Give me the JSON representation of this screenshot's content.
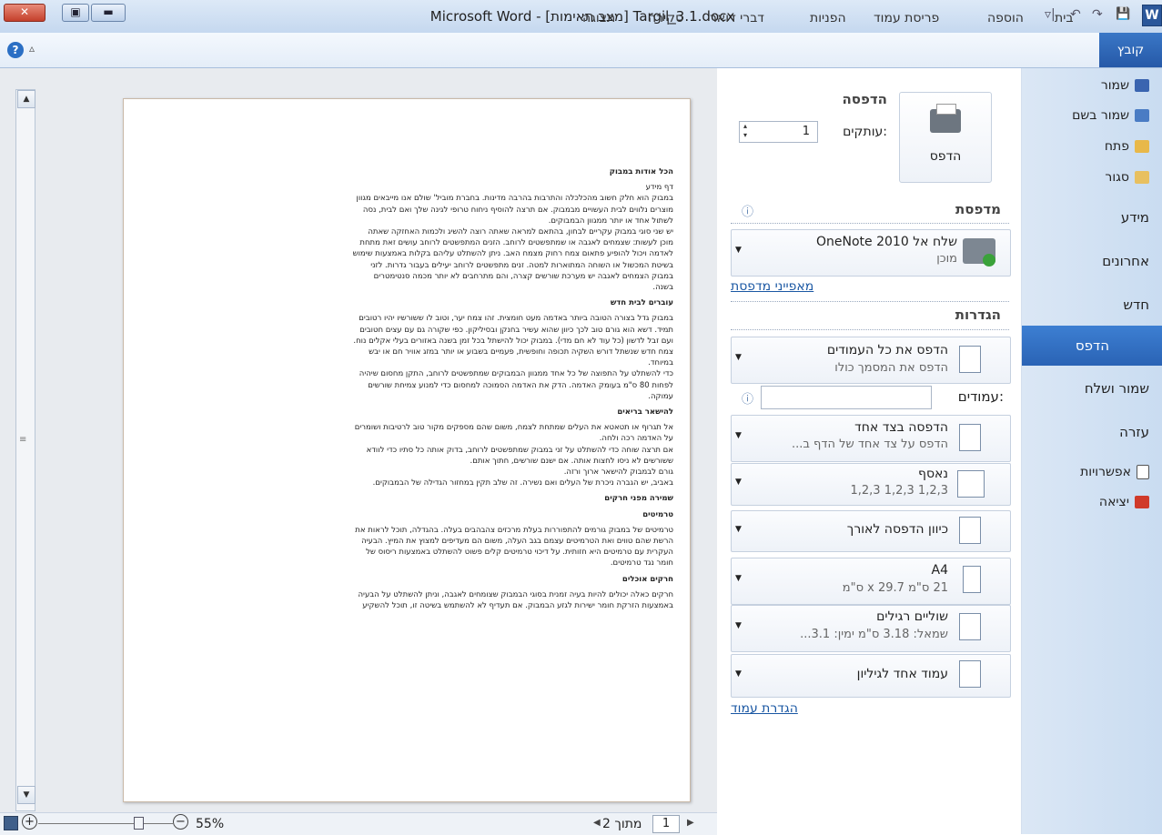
{
  "window": {
    "title": "Microsoft Word - [מצב תאימות] Targil_3.1.docx",
    "close": "✕",
    "max": "▣",
    "min": "▬",
    "qat": [
      "▿|",
      "↶",
      "↷",
      "💾"
    ],
    "word_icon": "W"
  },
  "ribbon": {
    "file_tab": "קובץ",
    "tabs": [
      "בית",
      "הוספה",
      "פריסת עמוד",
      "הפניות",
      "דברי דואר",
      "סקירה",
      "תצוגה"
    ],
    "help": "?",
    "collapse": "▵"
  },
  "nav": {
    "save": "שמור",
    "save_as": "שמור בשם",
    "open": "פתח",
    "close": "סגור",
    "info": "מידע",
    "recent": "אחרונים",
    "new": "חדש",
    "print": "הדפס",
    "save_send": "שמור ושלח",
    "help": "עזרה",
    "options": "אפשרויות",
    "exit": "יציאה"
  },
  "print": {
    "heading": "הדפסה",
    "print_button": "הדפס",
    "copies_label": "עותקים:",
    "copies_value": "1",
    "printer_heading": "מדפסת",
    "printer_name": "שלח אל OneNote 2010",
    "printer_status": "מוכן",
    "printer_props": "מאפייני מדפסת",
    "settings_heading": "הגדרות",
    "pages_label": "עמודים:",
    "pages_value": "",
    "info_icon": "ⓘ",
    "settings": [
      {
        "title": "הדפס את כל העמודים",
        "sub": "הדפס את המסמך כולו"
      },
      {
        "title": "הדפסה בצד אחד",
        "sub": "הדפס על צד אחד של הדף ב..."
      },
      {
        "title": "נאסף",
        "sub": "1,2,3   1,2,3   1,2,3"
      },
      {
        "title": "כיוון הדפסה לאורך",
        "sub": ""
      },
      {
        "title": "A4",
        "sub": "21 ס\"מ x 29.7 ס\"מ"
      },
      {
        "title": "שוליים רגילים",
        "sub": "שמאל: 3.18 ס\"מ   ימין: 3.1..."
      },
      {
        "title": "עמוד אחד לגיליון",
        "sub": ""
      }
    ],
    "page_setup": "הגדרת עמוד"
  },
  "preview": {
    "lines": [
      {
        "t": "הכל אודות במבוק",
        "h": true
      },
      {
        "t": "דף מידע",
        "h": false
      },
      {
        "t": "במבוק הוא חלק חשוב מהכלכלה והתרבות בהרבה מדינות. בחברת מוביל' שולם אנו מייבאים מגוון",
        "h": false
      },
      {
        "t": "מוצרים נלווים לבית העשויים מבמבוק. אם תרצה להוסיף ניחוח טרופי לגינה שלך ואם לבית, נסה",
        "h": false
      },
      {
        "t": "לשתול אחד או יותר ממגוון הבמבוקים.",
        "h": false
      },
      {
        "t": "יש שני סוגי במבוק עקריים לבחון, בהתאם למראה שאתה רוצה להשיג ולכמות האחזקה שאתה",
        "h": false
      },
      {
        "t": "מוכן לעשות: שצמחים לאגבה או שמתפשטים לרוחב. הזנים המתפשטים לרוחב עושים זאת מתחת",
        "h": false
      },
      {
        "t": "לאדמה ויכול להופיע פתאום צמח רחוק מצמח האב. ניתן להשתלט עליהם בקלות באמצעות שימוש",
        "h": false
      },
      {
        "t": "בשיטת המכשול או השוחה המתוארות למטה. זנים מתפשטים לרוחב יעילים בעבור גדרות. לזני",
        "h": false
      },
      {
        "t": "במבוק הצמחים לאגבה יש מערכת שורשים קצרה, והם מתרחבים לא יותר מכמה סנטימטרים",
        "h": false
      },
      {
        "t": "בשנה.",
        "h": false
      },
      {
        "t": "עוברים לבית חדש",
        "h": true
      },
      {
        "t": "במבוק גדל בצורה הטובה ביותר באדמה מעט חומצית. זהו צמח יער, וטוב לו ששורשיו יהיו רטובים",
        "h": false
      },
      {
        "t": "תמיד. דשא הוא גורם טוב לכך כיוון שהוא עשיר בחנקן ובסיליקון. כפי שקורה גם עם עצים חטובים",
        "h": false
      },
      {
        "t": "ועם זבל לדשון (כל עוד לא חם מדי). במבוק יכול להישתל בכל זמן בשנה באזורים בעלי אקלים נוח.",
        "h": false
      },
      {
        "t": "צמח חדש שנשתל דורש השקיה תכופה וחופשית, פעמיים בשבוע או יותר במזג אוויר חם או יבש",
        "h": false
      },
      {
        "t": "במיוחד.",
        "h": false
      },
      {
        "t": "כדי להשתלט על התפוצה של כל אחד ממגוון הבמבוקים שמתפשטים לרוחב, התקן מחסום שיהיה",
        "h": false
      },
      {
        "t": "לפחות 80 ס\"מ בעומק האדמה. הדק את האדמה הסמוכה למחסום כדי למנוע צמיחת שורשים",
        "h": false
      },
      {
        "t": "עמוקה.",
        "h": false
      },
      {
        "t": "להישאר בריאים",
        "h": true
      },
      {
        "t": "אל תגרוף או תטאטא את העלים שמתחת לצמח, משום שהם מספקים מקור טוב לרטיבות ושומרים",
        "h": false
      },
      {
        "t": "על האדמה רכה ולחה.",
        "h": false
      },
      {
        "t": "אם תרצה שוחה כדי להשתלט על זני במבוק שמתפשטים לרוחב, בדוק אותה כל סתיו כדי לוודא",
        "h": false
      },
      {
        "t": "ששורשים לא ניסו לחצות אותה. אם ישנם שורשים, חתוך אותם.",
        "h": false
      },
      {
        "t": "גורם לבמבוק להישאר ארוך ורזה.",
        "h": false
      },
      {
        "t": "באביב, יש הגברה ניכרת של העלים ואם נשירה. זה שלב תקין במחזור הגדילה של הבמבוקים.",
        "h": false
      },
      {
        "t": "שמירה מפני חרקים",
        "h": true
      },
      {
        "t": "טרמיטים",
        "h": true
      },
      {
        "t": "טרמיטים של במבוק גורמים להתפוררות בעלת מרכזים צהבהבים בעלה. בהגדלה, תוכל לראות את",
        "h": false
      },
      {
        "t": "הרשת שהם טווים ואת הטרמיטים עצמם בגב העלה, משום הם מעדיפים למצוץ את המיץ. הבעיה",
        "h": false
      },
      {
        "t": "העקרית עם טרמיטים היא חזותית. על דיכוי טרמיטים קלים פשוט להשתלט באמצעות ריסוס של",
        "h": false
      },
      {
        "t": "חומר נגד טרמיטים.",
        "h": false
      },
      {
        "t": "חרקים אוכלים",
        "h": true
      },
      {
        "t": "חרקים כאלה יכולים להיות בעיה זמנית בסוגי הבמבוק שצומחים לאגבה, וניתן להשתלט על הבעיה",
        "h": false
      },
      {
        "t": "באמצעות הזרקת חומר ישירות לגזע הבמבוק. אם תעדיף לא להשתמש בשיטה זו, תוכל להשקיע",
        "h": false
      }
    ]
  },
  "status": {
    "page_current": "1",
    "page_of": "מתוך 2",
    "zoom": "55%",
    "prev": "◀",
    "next": "▶",
    "zoom_in": "+",
    "zoom_out": "−"
  }
}
